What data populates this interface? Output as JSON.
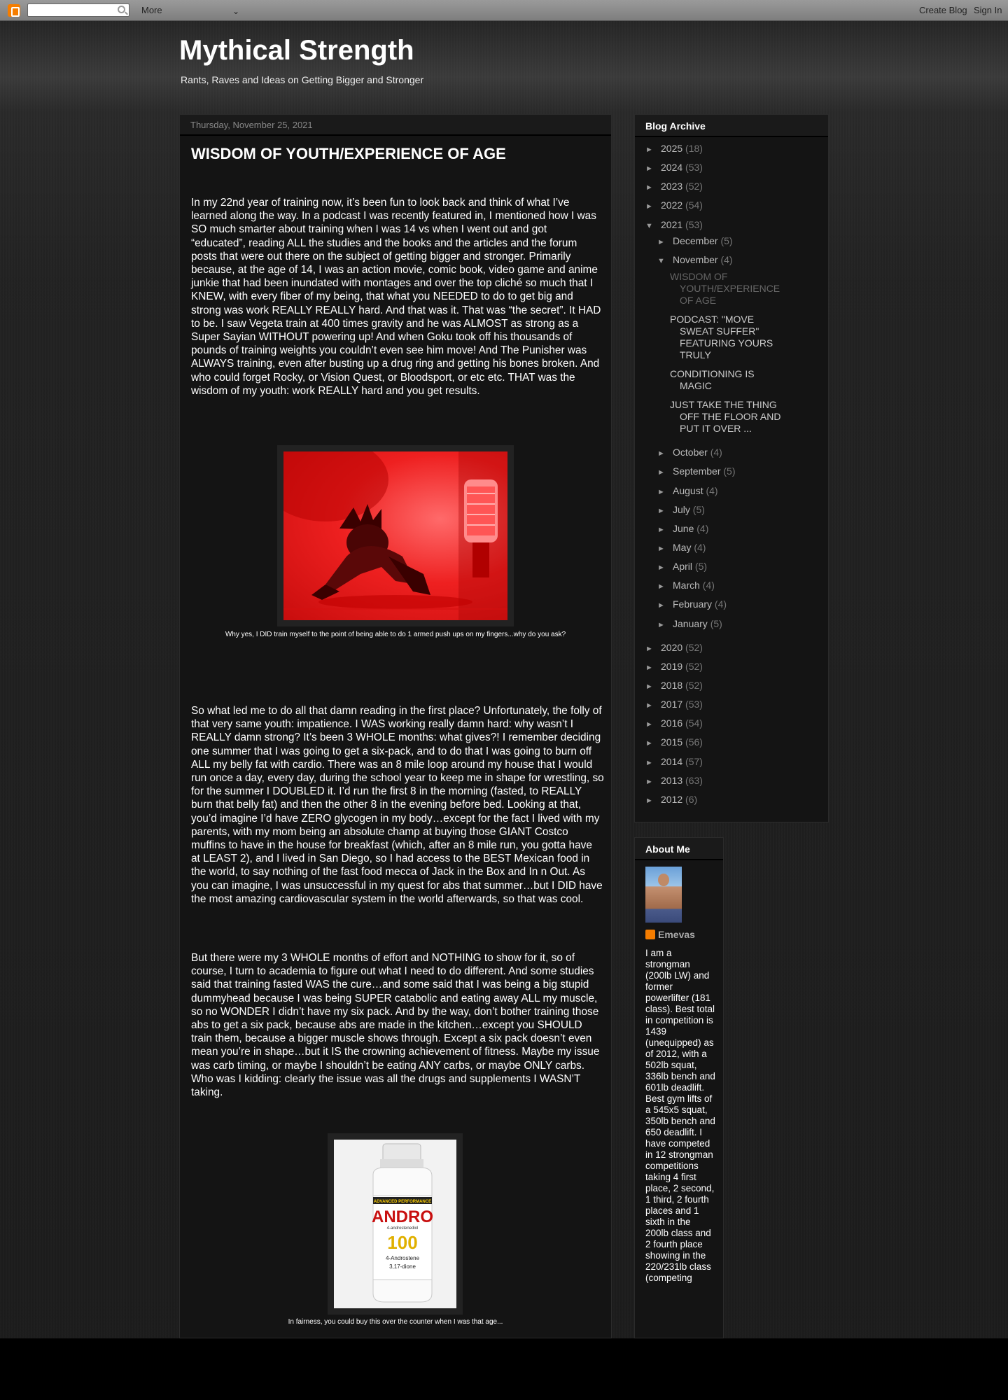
{
  "navbar": {
    "more_label": "More",
    "create_blog": "Create Blog",
    "sign_in": "Sign In"
  },
  "header": {
    "title": "Mythical Strength",
    "description": "Rants, Raves and Ideas on Getting Bigger and Stronger"
  },
  "post": {
    "date": "Thursday, November 25, 2021",
    "title": "WISDOM OF YOUTH/EXPERIENCE OF AGE",
    "para1": "In my 22nd year of training now, it’s been fun to look back and think of what I’ve learned along the way.  In a podcast I was recently featured in, I mentioned how I was SO much smarter about training when I was 14 vs when I went out and got “educated”, reading ALL the studies and the books and the articles and the forum posts that were out there on the subject of getting bigger and stronger.   Primarily because, at the age of 14, I was an action movie, comic book, video game and anime junkie that had been inundated with montages and over the top cliché so much that I KNEW, with every fiber of my being, that what you NEEDED to do to get big and strong was work REALLY REALLY hard.  And that was it.  That was “the secret”.  It HAD to be.  I saw Vegeta train at 400 times gravity and he was ALMOST as strong as a Super Sayian WITHOUT powering up!  And when Goku took off his thousands of pounds of training weights you couldn’t even see him move!  And The Punisher was ALWAYS training, even after busting up a drug ring and getting his bones broken.  And who could forget Rocky, or Vision Quest, or Bloodsport, or etc etc.  THAT was the wisdom of my youth: work REALLY hard and you get results.",
    "caption1": "Why yes, I DID train myself to the point of being able to do 1 armed push ups on my fingers...why do you ask?",
    "para2": "So what led me to do all that damn reading in the first place?  Unfortunately, the folly of that very same youth: impatience.  I WAS working really damn hard: why wasn’t I REALLY damn strong?  It’s been 3 WHOLE months: what gives?!  I remember deciding one summer that I was going to get a six-pack, and to do that I was going to burn off ALL my belly fat with cardio.  There was an 8 mile loop around my house that I would run once a day, every day, during the school year to keep me in shape for wrestling, so for the summer I DOUBLED it.  I’d run the first 8 in the morning (fasted, to REALLY burn that belly fat) and then the other 8 in the evening before bed.  Looking at that, you’d imagine I’d have ZERO glycogen in my body…except for the fact I lived with my parents, with my mom being an absolute champ at buying those GIANT Costco muffins to have in the house for breakfast (which, after an 8 mile run, you gotta have at LEAST 2), and I lived in San Diego, so I had access to the BEST Mexican food in the world, to say nothing of the fast food mecca of Jack in the Box and In n Out.  As you can imagine, I was unsuccessful in my quest for abs that summer…but I DID have the most amazing cardiovascular system in the world afterwards, so that was cool.",
    "para3": "But there were my 3 WHOLE months of effort and NOTHING to show for it, so of course, I turn to academia to figure out what I need to do different.  And some studies said that training fasted WAS the cure…and some said that I was being a big stupid dummyhead because I was being SUPER catabolic and eating away ALL my muscle, so no WONDER I didn’t have my six pack.  And by the way, don’t bother training those abs to get a six pack, because abs are made in the kitchen…except you SHOULD train them, because a bigger muscle shows through.  Except a six pack doesn’t even mean you’re in shape…but it IS the crowning achievement of fitness.  Maybe my issue was carb timing, or maybe I shouldn’t be eating ANY carbs, or maybe ONLY carbs.  Who was I kidding: clearly the issue was all the drugs and supplements I WASN’T taking.",
    "caption2": "In fairness, you could buy this over the counter when I was that age...",
    "bottle_label": {
      "top": "ADVANCED PERFORMANCE",
      "brand": "ANDRO",
      "sub": "4-androstenediol",
      "num": "100",
      "bottom": "4-Androstene",
      "bottom2": "3,17-dione"
    }
  },
  "archive": {
    "title": "Blog Archive",
    "expanded_toggle": "▼",
    "collapsed_toggle": "►",
    "years_top": [
      {
        "label": "2025",
        "count": "(18)"
      },
      {
        "label": "2024",
        "count": "(53)"
      },
      {
        "label": "2023",
        "count": "(52)"
      },
      {
        "label": "2022",
        "count": "(54)"
      }
    ],
    "year_2021": {
      "label": "2021",
      "count": "(53)"
    },
    "december": {
      "label": "December",
      "count": "(5)"
    },
    "november": {
      "label": "November",
      "count": "(4)"
    },
    "november_posts": [
      "WISDOM OF YOUTH/EXPERIENCE OF AGE",
      "PODCAST: \"MOVE SWEAT SUFFER\" FEATURING YOURS TRULY",
      "CONDITIONING IS MAGIC",
      "JUST TAKE THE THING OFF THE FLOOR AND PUT IT OVER ..."
    ],
    "months_rest": [
      {
        "label": "October",
        "count": "(4)"
      },
      {
        "label": "September",
        "count": "(5)"
      },
      {
        "label": "August",
        "count": "(4)"
      },
      {
        "label": "July",
        "count": "(5)"
      },
      {
        "label": "June",
        "count": "(4)"
      },
      {
        "label": "May",
        "count": "(4)"
      },
      {
        "label": "April",
        "count": "(5)"
      },
      {
        "label": "March",
        "count": "(4)"
      },
      {
        "label": "February",
        "count": "(4)"
      },
      {
        "label": "January",
        "count": "(5)"
      }
    ],
    "years_bottom": [
      {
        "label": "2020",
        "count": "(52)"
      },
      {
        "label": "2019",
        "count": "(52)"
      },
      {
        "label": "2018",
        "count": "(52)"
      },
      {
        "label": "2017",
        "count": "(53)"
      },
      {
        "label": "2016",
        "count": "(54)"
      },
      {
        "label": "2015",
        "count": "(56)"
      },
      {
        "label": "2014",
        "count": "(57)"
      },
      {
        "label": "2013",
        "count": "(63)"
      },
      {
        "label": "2012",
        "count": "(6)"
      }
    ]
  },
  "about": {
    "title": "About Me",
    "name": "Emevas",
    "bio": "I am a strongman (200lb LW) and former powerlifter (181 class). Best total in competition is 1439 (unequipped) as of 2012, with a 502lb squat, 336lb bench and 601lb deadlift. Best gym lifts of a 545x5 squat, 350lb bench and 650 deadlift. I have competed in 12 strongman competitions taking 4 first place, 2 second, 1 third, 2 fourth places and 1 sixth in the 200lb class and 2 fourth place showing in the 220/231lb class (competing"
  }
}
